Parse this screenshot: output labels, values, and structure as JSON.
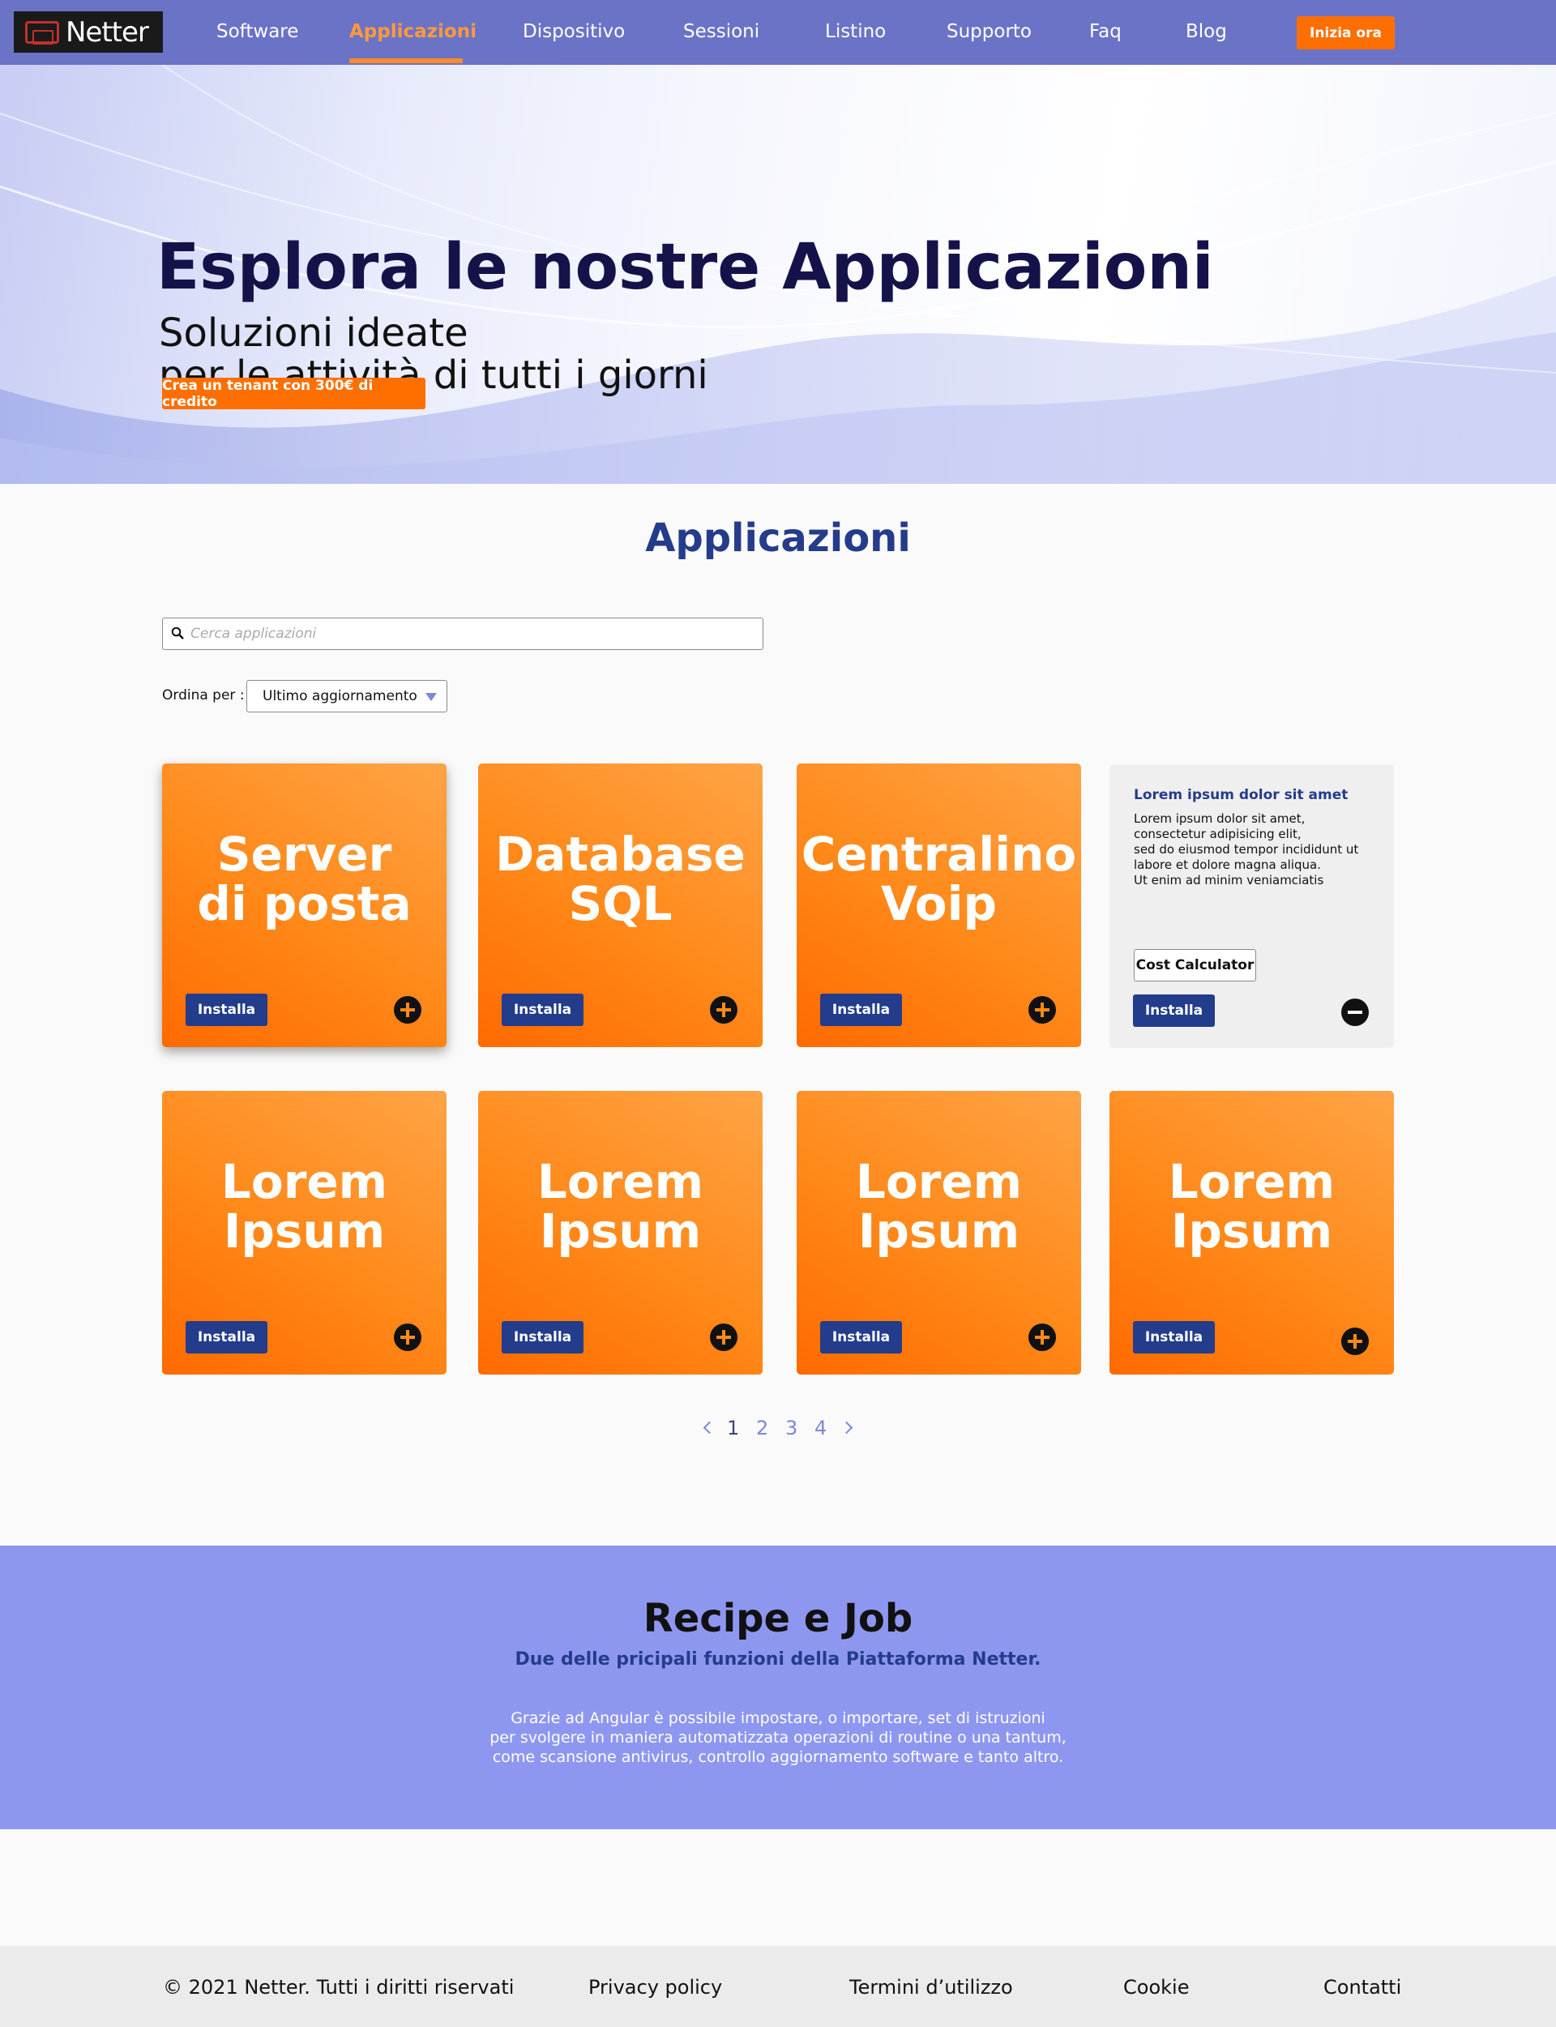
{
  "nav": {
    "logo_text": "Netter",
    "items": [
      {
        "label": "Software"
      },
      {
        "label": "Applicazioni"
      },
      {
        "label": "Dispositivo"
      },
      {
        "label": "Sessioni"
      },
      {
        "label": "Listino"
      },
      {
        "label": "Supporto"
      },
      {
        "label": "Faq"
      },
      {
        "label": "Blog"
      }
    ],
    "active": "Applicazioni",
    "cta": "Inizia ora"
  },
  "hero": {
    "title": "Esplora le nostre Applicazioni",
    "subtitle_line1": "Soluzioni ideate",
    "subtitle_line2": "per le attività di tutti i giorni",
    "button": "Crea un tenant con 300€ di credito"
  },
  "apps": {
    "section_title": "Applicazioni",
    "search_placeholder": "Cerca applicazioni",
    "sort_label": "Ordina per :",
    "sort_value": "Ultimo aggiornamento",
    "cards": [
      {
        "line1": "Server",
        "line2": "di posta",
        "button": "Installa"
      },
      {
        "line1": "Database",
        "line2": "SQL",
        "button": "Installa"
      },
      {
        "line1": "Centralino",
        "line2": "Voip",
        "button": "Installa"
      },
      {
        "line1": "Lorem",
        "line2": "Ipsum",
        "button": "Installa"
      },
      {
        "line1": "Lorem",
        "line2": "Ipsum",
        "button": "Installa"
      },
      {
        "line1": "Lorem",
        "line2": "Ipsum",
        "button": "Installa"
      },
      {
        "line1": "Lorem",
        "line2": "Ipsum",
        "button": "Installa"
      }
    ],
    "info_card": {
      "title": "Lorem ipsum dolor sit amet",
      "body": "Lorem ipsum dolor sit amet,\nconsectetur adipisicing elit,\nsed do eiusmod tempor incididunt ut\nlabore et dolore magna aliqua.\nUt enim ad minim veniamciatis",
      "calc_button": "Cost Calculator",
      "button": "Installa"
    }
  },
  "pagination": {
    "pages": [
      "1",
      "2",
      "3",
      "4"
    ],
    "current": "1"
  },
  "recipe": {
    "title": "Recipe e Job",
    "subtitle": "Due delle pricipali funzioni della Piattaforma Netter.",
    "body": "Grazie ad Angular è possibile impostare, o importare, set di istruzioni\nper svolgere in maniera automatizzata operazioni di routine o una tantum,\ncome scansione antivirus, controllo aggiornamento software e tanto altro."
  },
  "footer": {
    "copyright": "© 2021 Netter. Tutti i diritti riservati",
    "privacy": "Privacy policy",
    "terms": "Termini d’utilizzo",
    "cookie": "Cookie",
    "contacts": "Contatti"
  },
  "colors": {
    "nav_bg": "#6b73c7",
    "accent_orange": "#ff6f00",
    "brand_blue": "#243c8a",
    "recipe_bg": "#8e97f0"
  }
}
